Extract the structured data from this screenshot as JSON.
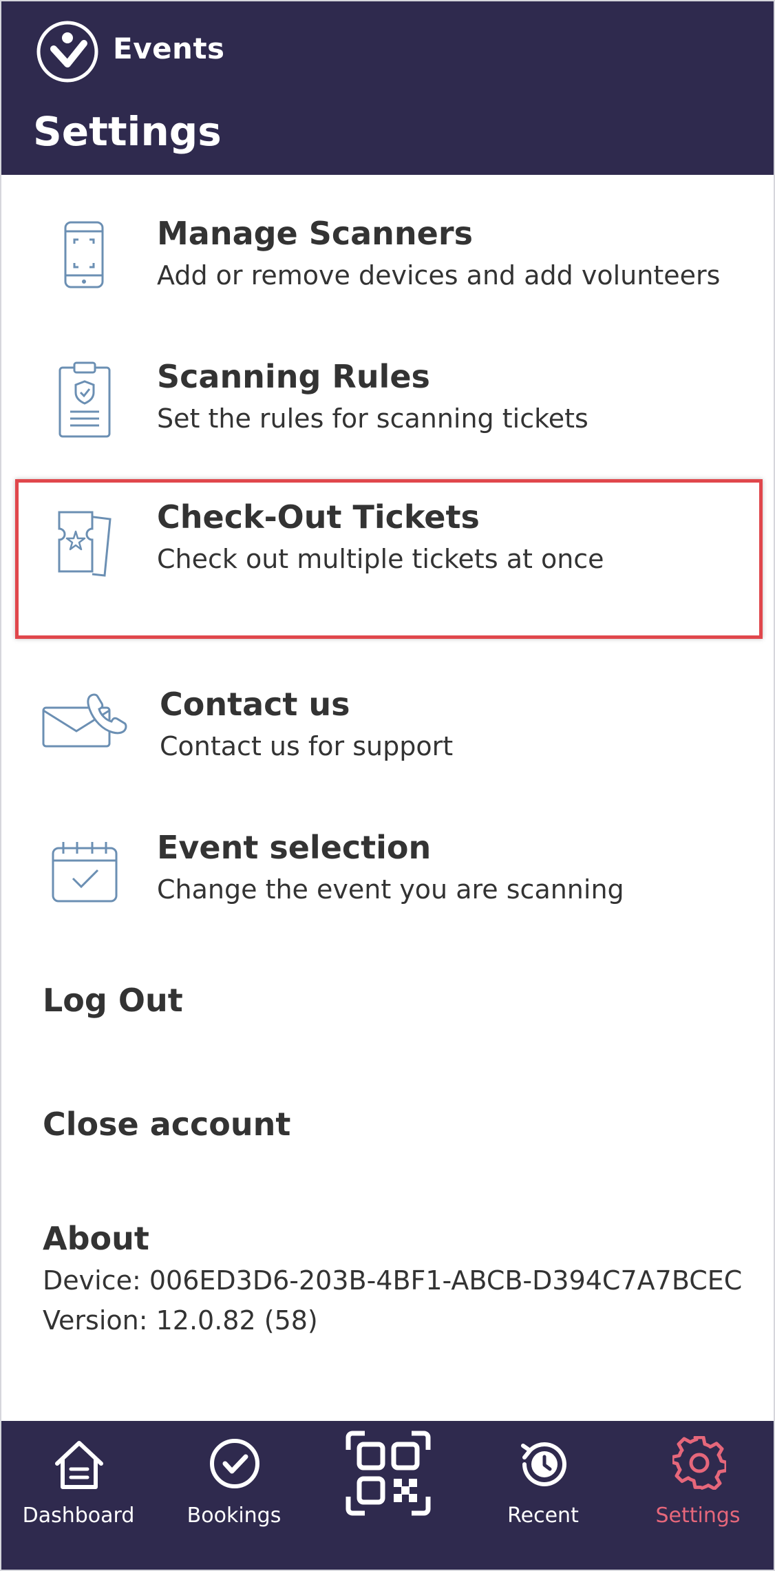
{
  "header": {
    "brand": "Events",
    "title": "Settings"
  },
  "settings": [
    {
      "icon": "phone-scanner-icon",
      "title": "Manage Scanners",
      "subtitle": "Add or remove devices and add volunteers"
    },
    {
      "icon": "clipboard-shield-icon",
      "title": "Scanning Rules",
      "subtitle": "Set the rules for scanning tickets"
    },
    {
      "icon": "ticket-star-icon",
      "title": "Check-Out Tickets",
      "subtitle": "Check out multiple tickets at once"
    },
    {
      "icon": "envelope-phone-icon",
      "title": "Contact us",
      "subtitle": "Contact us for support"
    },
    {
      "icon": "calendar-check-icon",
      "title": "Event selection",
      "subtitle": "Change the event you are scanning"
    }
  ],
  "account": {
    "logout": "Log Out",
    "close": "Close account"
  },
  "about": {
    "title": "About",
    "device": "Device: 006ED3D6-203B-4BF1-ABCB-D394C7A7BCEC",
    "version": "Version: 12.0.82 (58)"
  },
  "tabbar": {
    "tabs": [
      {
        "label": "Dashboard",
        "icon": "home-icon"
      },
      {
        "label": "Bookings",
        "icon": "check-circle-icon"
      },
      {
        "label": "",
        "icon": "qr-code-icon"
      },
      {
        "label": "Recent",
        "icon": "history-icon"
      },
      {
        "label": "Settings",
        "icon": "gear-icon",
        "active": true
      }
    ]
  },
  "colors": {
    "header_bg": "#2f2a4e",
    "icon_stroke": "#6b8fb3",
    "highlight": "#e0474c",
    "active_tab": "#e6677b"
  }
}
